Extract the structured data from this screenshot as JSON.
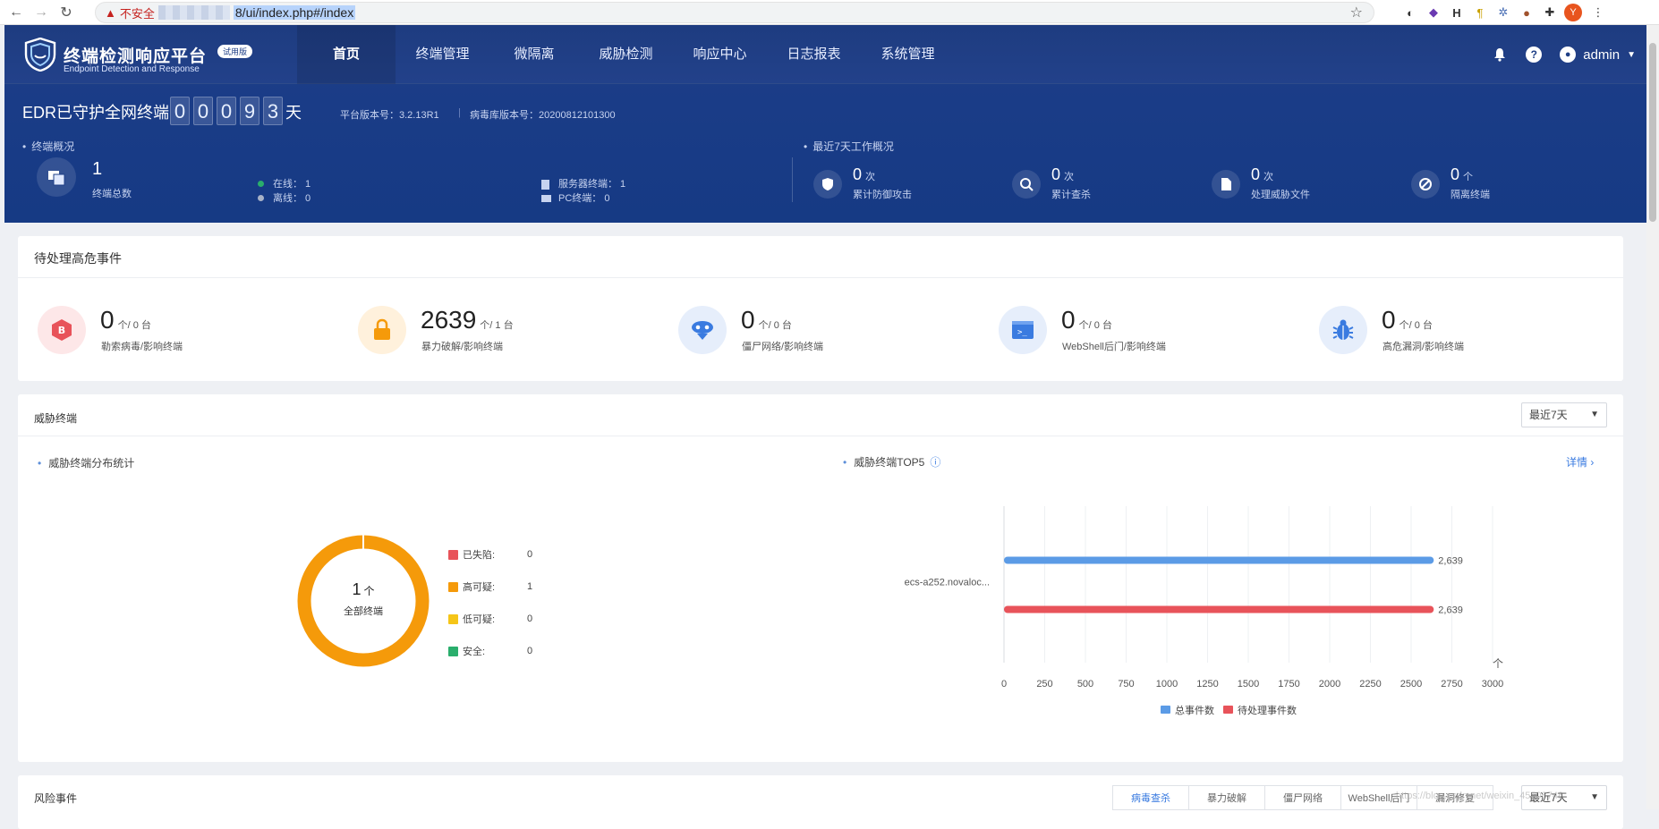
{
  "browser": {
    "warning": "不安全",
    "url": "8/ui/index.php#/index",
    "back": "←",
    "forward": "→",
    "reload": "↻",
    "star": "☆",
    "profile_initial": "Y"
  },
  "brand": {
    "title": "终端检测响应平台",
    "subtitle": "Endpoint Detection and Response",
    "badge": "试用版"
  },
  "nav": {
    "items": [
      {
        "label": "首页"
      },
      {
        "label": "终端管理"
      },
      {
        "label": "微隔离"
      },
      {
        "label": "威胁检测"
      },
      {
        "label": "响应中心"
      },
      {
        "label": "日志报表"
      },
      {
        "label": "系统管理"
      }
    ]
  },
  "user": {
    "name": "admin"
  },
  "guard": {
    "title": "EDR已守护全网终端",
    "digits": [
      "0",
      "0",
      "0",
      "9",
      "3"
    ],
    "unit": "天",
    "platform_version": "平台版本号：3.2.13R1",
    "virus_db_version": "病毒库版本号：20200812101300"
  },
  "overview": {
    "title": "终端概况",
    "total": "1",
    "total_label": "终端总数",
    "online": "在线：  1",
    "offline": "离线：  0",
    "server": "服务器终端：  1",
    "pc": "PC终端：     0"
  },
  "recent": {
    "title": "最近7天工作概况",
    "items": [
      {
        "num": "0",
        "unit": "次",
        "label": "累计防御攻击"
      },
      {
        "num": "0",
        "unit": "次",
        "label": "累计查杀"
      },
      {
        "num": "0",
        "unit": "次",
        "label": "处理威胁文件"
      },
      {
        "num": "0",
        "unit": "个",
        "label": "隔离终端"
      }
    ]
  },
  "pending": {
    "title": "待处理高危事件",
    "items": [
      {
        "num": "0",
        "unit": "个/ 0 台",
        "label": "勒索病毒/影响终端"
      },
      {
        "num": "2639",
        "unit": "个/ 1 台",
        "label": "暴力破解/影响终端"
      },
      {
        "num": "0",
        "unit": "个/ 0 台",
        "label": "僵尸网络/影响终端"
      },
      {
        "num": "0",
        "unit": "个/ 0 台",
        "label": "WebShell后门/影响终端"
      },
      {
        "num": "0",
        "unit": "个/ 0 台",
        "label": "高危漏洞/影响终端"
      }
    ]
  },
  "threat": {
    "title": "威胁终端",
    "range": "最近7天",
    "dist_title": "威胁终端分布统计",
    "top_title": "威胁终端TOP5",
    "detail": "详情 ›",
    "donut": {
      "center_num": "1",
      "center_unit": "个",
      "center_label": "全部终端",
      "legend": [
        {
          "label": "已失陷:",
          "value": "0",
          "color": "#e8535a"
        },
        {
          "label": "高可疑:",
          "value": "1",
          "color": "#f59a0a"
        },
        {
          "label": "低可疑:",
          "value": "0",
          "color": "#f5c518"
        },
        {
          "label": "安全:",
          "value": "0",
          "color": "#2aae6c"
        }
      ]
    }
  },
  "chart_data": {
    "type": "bar",
    "orientation": "horizontal",
    "categories": [
      "ecs-a252.novaloc..."
    ],
    "series": [
      {
        "name": "总事件数",
        "values": [
          2639
        ],
        "color": "#5b9be6"
      },
      {
        "name": "待处理事件数",
        "values": [
          2639
        ],
        "color": "#e8535a"
      }
    ],
    "xlim": [
      0,
      3000
    ],
    "xticks": [
      0,
      250,
      500,
      750,
      1000,
      1250,
      1500,
      1750,
      2000,
      2250,
      2500,
      2750,
      3000
    ],
    "xlabel": "个",
    "data_labels": [
      "2,639",
      "2,639"
    ],
    "legend_position": "bottom"
  },
  "risk": {
    "title": "风险事件",
    "tabs": [
      "病毒查杀",
      "暴力破解",
      "僵尸网络",
      "WebShell后门",
      "漏洞修复"
    ],
    "range": "最近7天"
  },
  "watermark": "https://blog.csdn.net/weixin_45508748"
}
